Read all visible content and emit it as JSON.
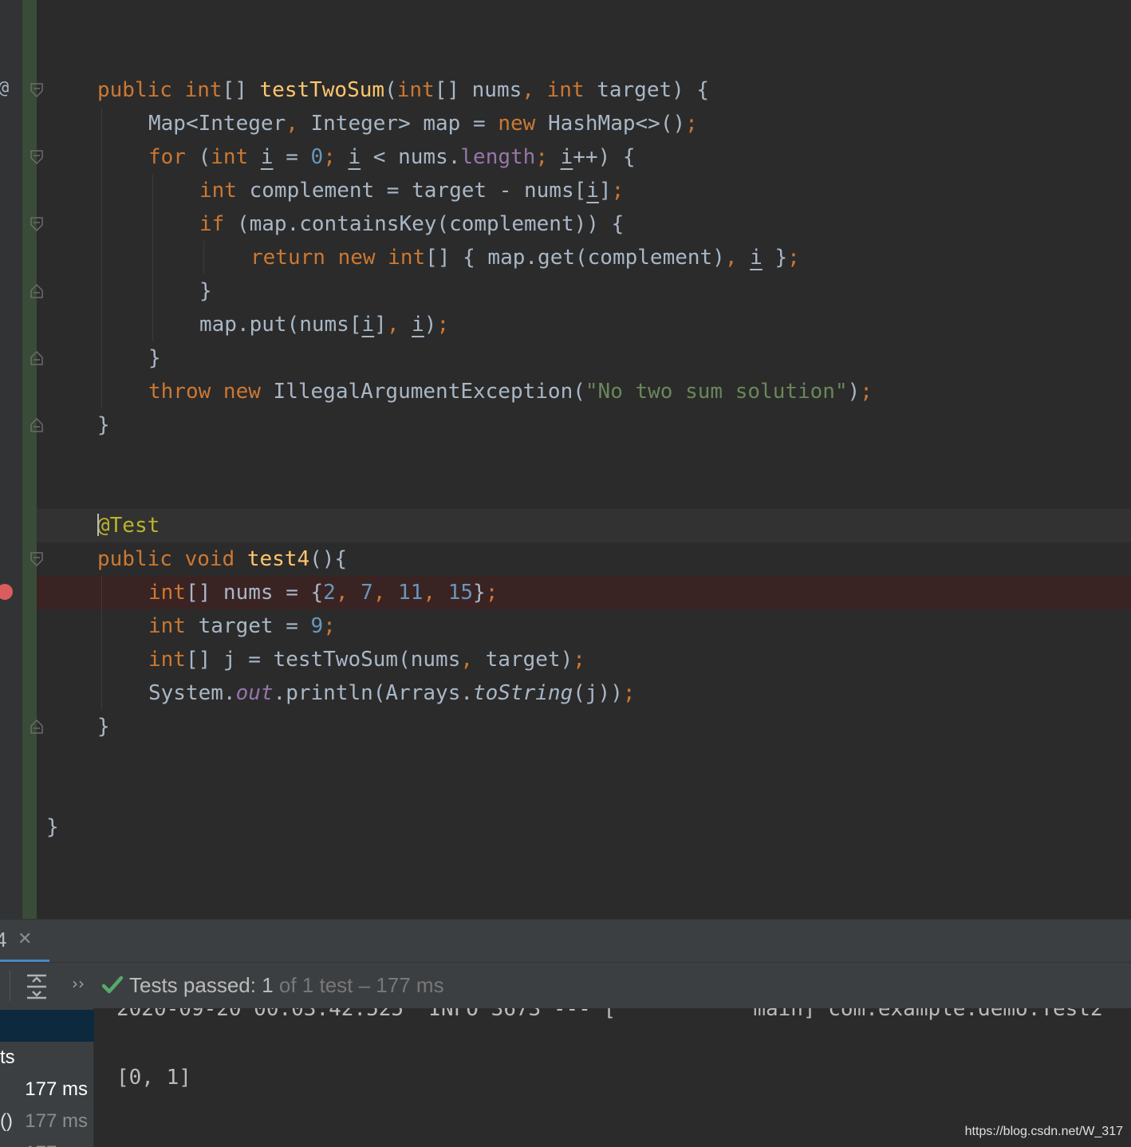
{
  "gutter": {
    "override_marker": "@"
  },
  "editor": {
    "method1": {
      "sig_public": "public ",
      "sig_int": "int",
      "sig_arr": "[] ",
      "sig_name": "testTwoSum",
      "sig_paren": "(",
      "sig_int2": "int",
      "sig_arr2": "[] nums",
      "sig_comma": ", ",
      "sig_int3": "int",
      "sig_rest": " target) {",
      "l2_a": "Map<Integer",
      "l2_b": ", ",
      "l2_c": "Integer> map = ",
      "l2_new": "new ",
      "l2_d": "HashMap<>()",
      "l2_semi": ";",
      "l3_for": "for ",
      "l3_a": "(",
      "l3_int": "int ",
      "l3_i1": "i",
      "l3_b": " = ",
      "l3_0": "0",
      "l3_s1": "; ",
      "l3_i2": "i",
      "l3_c": " < nums.",
      "l3_len": "length",
      "l3_s2": "; ",
      "l3_i3": "i",
      "l3_d": "++) {",
      "l4_int": "int ",
      "l4_a": "complement = target - nums[",
      "l4_i": "i",
      "l4_b": "]",
      "l4_semi": ";",
      "l5_if": "if ",
      "l5_a": "(map.containsKey(complement)) {",
      "l6_ret": "return new int",
      "l6_a": "[] { map.get(complement)",
      "l6_comma": ", ",
      "l6_i": "i",
      "l6_b": " }",
      "l6_semi": ";",
      "l7": "}",
      "l8_a": "map.put(nums[",
      "l8_i1": "i",
      "l8_b": "]",
      "l8_comma": ", ",
      "l8_i2": "i",
      "l8_c": ")",
      "l8_semi": ";",
      "l9": "}",
      "l10_throw": "throw new ",
      "l10_a": "IllegalArgumentException(",
      "l10_str": "\"No two sum solution\"",
      "l10_b": ")",
      "l10_semi": ";",
      "l11": "}"
    },
    "method2": {
      "annotation": "@Test",
      "sig_kw": "public void ",
      "sig_name": "test4",
      "sig_rest": "(){",
      "l2_int": "int",
      "l2_a": "[] nums = {",
      "l2_n1": "2",
      "l2_c1": ", ",
      "l2_n2": "7",
      "l2_c2": ", ",
      "l2_n3": "11",
      "l2_c3": ", ",
      "l2_n4": "15",
      "l2_b": "}",
      "l2_semi": ";",
      "l3_int": "int ",
      "l3_a": "target = ",
      "l3_n": "9",
      "l3_semi": ";",
      "l4_int": "int",
      "l4_a": "[] j = testTwoSum(nums",
      "l4_comma": ", ",
      "l4_b": "target)",
      "l4_semi": ";",
      "l5_a": "System.",
      "l5_out": "out",
      "l5_b": ".println(Arrays.",
      "l5_ts": "toString",
      "l5_c": "(j))",
      "l5_semi": ";",
      "l6": "}"
    },
    "class_close": "}"
  },
  "run_panel": {
    "tab_label": "4",
    "status_passed": "Tests passed: ",
    "status_count": "1",
    "status_rest": " of 1 test – 177 ms",
    "tree": [
      {
        "label": "ts",
        "time": "177 ms",
        "selected": true
      },
      {
        "label": "",
        "time": "177 ms",
        "selected": false
      },
      {
        "label": "()",
        "time": "177 ms",
        "selected": false
      }
    ],
    "console": {
      "log_line": "2020-09-20 00:03:42.525  INFO 3673 --- [           main] com.example.demo.Test2",
      "output": "[0, 1]"
    }
  },
  "watermark": "https://blog.csdn.net/W_317"
}
